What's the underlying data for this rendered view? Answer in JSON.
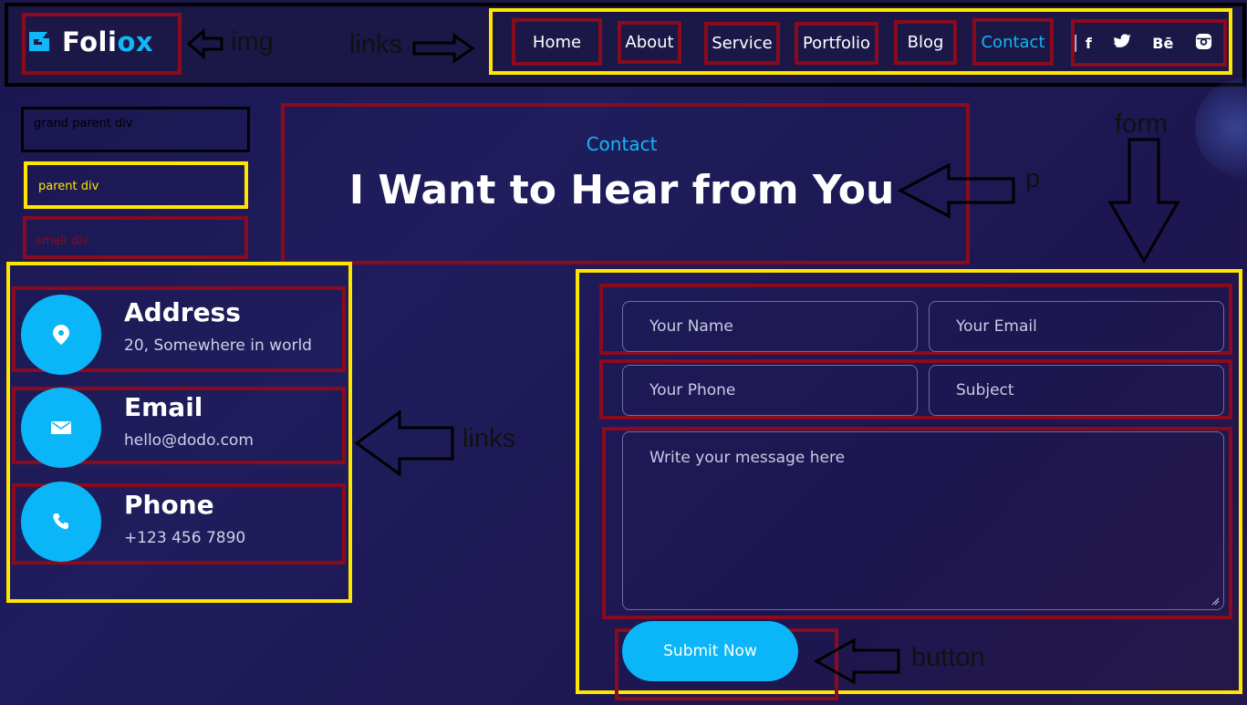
{
  "brand": {
    "name_prefix": "Foli",
    "name_accent": "ox"
  },
  "nav": {
    "items": [
      {
        "label": "Home"
      },
      {
        "label": "About"
      },
      {
        "label": "Service"
      },
      {
        "label": "Portfolio"
      },
      {
        "label": "Blog"
      },
      {
        "label": "Contact",
        "active": true
      }
    ],
    "divider": "|",
    "social": [
      "f",
      "t",
      "Bē",
      "ig"
    ]
  },
  "annotations": {
    "img": "img",
    "links_top": "links",
    "p": "p",
    "form": "form",
    "links_side": "links",
    "button": "button",
    "grand_parent_div": "grand parent div",
    "parent_div": "parent div",
    "small_div": "small div"
  },
  "hero": {
    "eyebrow": "Contact",
    "title": "I Want to Hear from You"
  },
  "contact_info": [
    {
      "icon": "location-icon",
      "title": "Address",
      "text": "20, Somewhere in world"
    },
    {
      "icon": "mail-icon",
      "title": "Email",
      "text": "hello@dodo.com"
    },
    {
      "icon": "phone-icon",
      "title": "Phone",
      "text": "+123 456 7890"
    }
  ],
  "form": {
    "name_placeholder": "Your Name",
    "email_placeholder": "Your Email",
    "phone_placeholder": "Your Phone",
    "subject_placeholder": "Subject",
    "message_placeholder": "Write your message here",
    "submit_label": "Submit Now"
  },
  "colors": {
    "accent": "#0ab6f7",
    "annotation_yellow": "#ffe600",
    "annotation_red": "#8a0a1e",
    "annotation_black": "#000000"
  }
}
